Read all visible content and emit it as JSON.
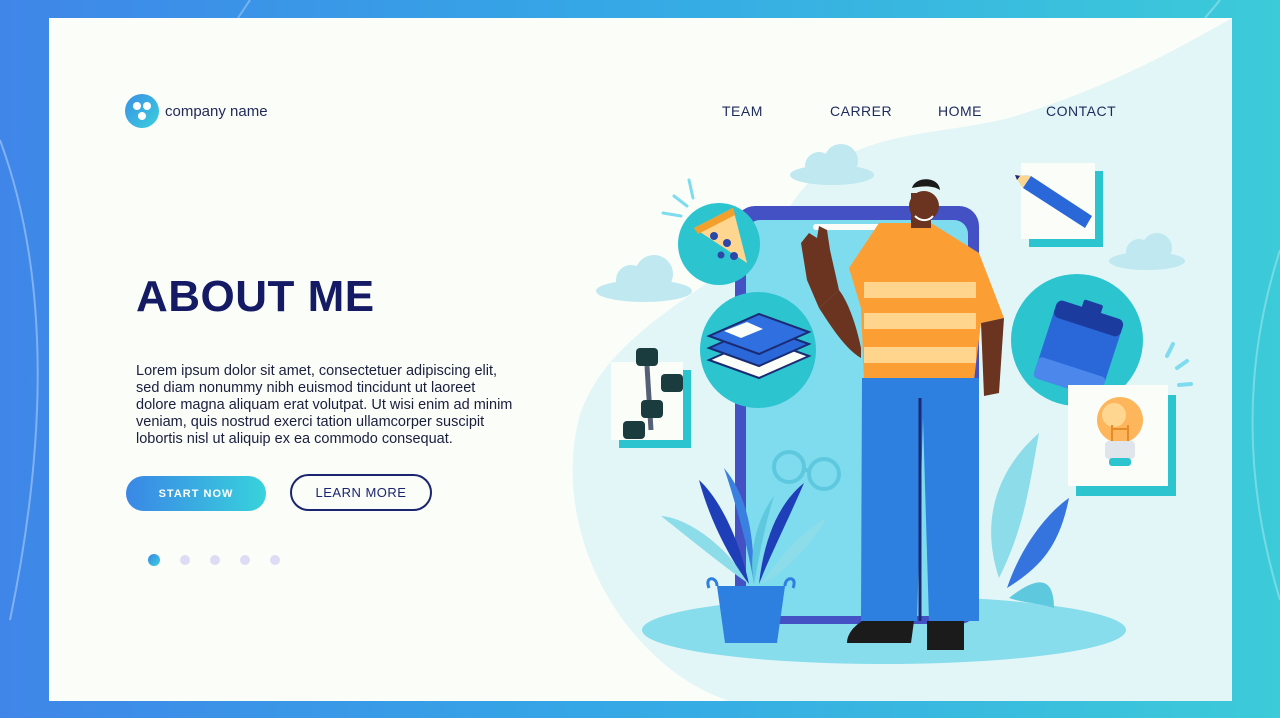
{
  "brand": {
    "name": "company name",
    "logo_icon": "three-dots-circle-icon"
  },
  "nav": {
    "items": [
      {
        "label": "TEAM"
      },
      {
        "label": "CARRER"
      },
      {
        "label": "HOME"
      },
      {
        "label": "CONTACT"
      }
    ]
  },
  "hero": {
    "title": "ABOUT ME",
    "body": "Lorem ipsum dolor sit amet, consectetuer adipiscing elit, sed diam nonummy nibh euismod tincidunt ut laoreet dolore magna aliquam erat volutpat. Ut wisi enim ad minim veniam, quis nostrud exerci tation ullamcorper suscipit lobortis nisl ut aliquip ex ea commodo consequat.",
    "primary_button": "START NOW",
    "secondary_button": "LEARN MORE"
  },
  "carousel": {
    "total_slides": 5,
    "active_index": 0
  },
  "illustration": {
    "items": [
      "pizza-icon",
      "books-icon",
      "dumbbell-icon",
      "pencil-icon",
      "battery-icon",
      "lightbulb-icon",
      "glasses-icon",
      "potted-plant",
      "smartphone",
      "person-waving",
      "cloud-icon"
    ]
  },
  "colors": {
    "background_gradient_start": "#3f86e8",
    "background_gradient_end": "#3ccbd9",
    "card": "#fbfdf9",
    "title": "#141a63",
    "accent_teal": "#3ccbd9",
    "accent_blue": "#2d7fe0",
    "shirt_orange": "#fb9f34"
  }
}
